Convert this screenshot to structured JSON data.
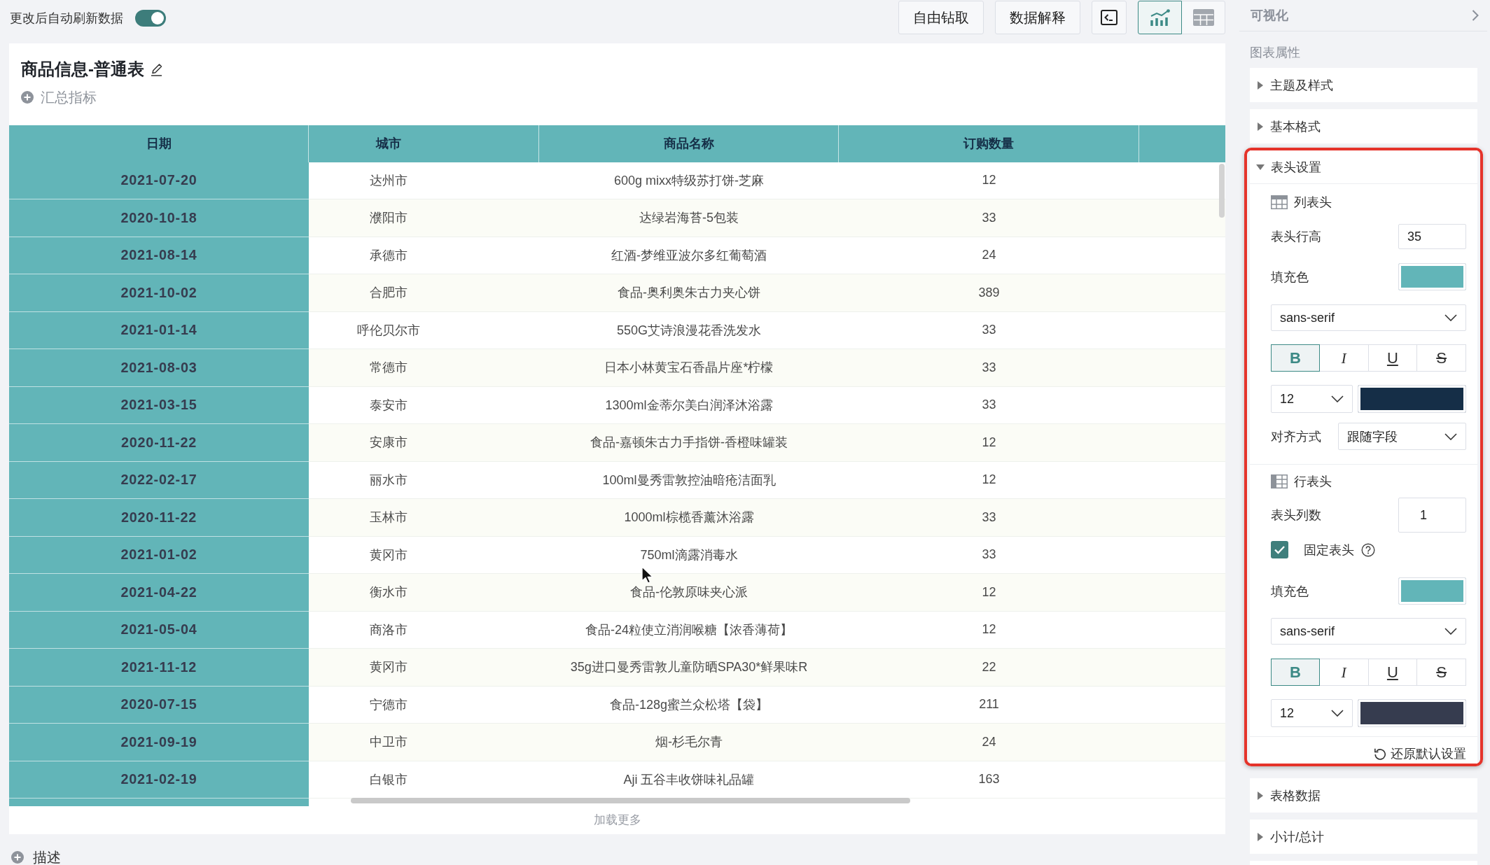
{
  "toolbar": {
    "auto_refresh": {
      "label": "更改后自动刷新数据",
      "on": true
    },
    "buttons": [
      {
        "label": "自由钻取"
      },
      {
        "label": "数据解释"
      }
    ],
    "view_modes": [
      {
        "kind": "chart",
        "selected": true
      },
      {
        "kind": "table",
        "selected": false
      }
    ]
  },
  "report": {
    "title": "商品信息-普通表",
    "summary": "汇总指标",
    "table": {
      "columns": [
        "日期",
        "城市",
        "商品名称",
        "订购数量"
      ],
      "rows": [
        [
          "2021-07-20",
          "达州市",
          "600g mixx特级苏打饼-芝麻",
          "12"
        ],
        [
          "2020-10-18",
          "濮阳市",
          "达绿岩海苔-5包装",
          "33"
        ],
        [
          "2021-08-14",
          "承德市",
          "红酒-梦维亚波尔多红葡萄酒",
          "24"
        ],
        [
          "2021-10-02",
          "合肥市",
          "食品-奥利奥朱古力夹心饼",
          "389"
        ],
        [
          "2021-01-14",
          "呼伦贝尔市",
          "550G艾诗浪漫花香洗发水",
          "33"
        ],
        [
          "2021-08-03",
          "常德市",
          "日本小林黄宝石香晶片座*柠檬",
          "33"
        ],
        [
          "2021-03-15",
          "泰安市",
          "1300ml金蒂尔美白润泽沐浴露",
          "33"
        ],
        [
          "2020-11-22",
          "安康市",
          "食品-嘉顿朱古力手指饼-香橙味罐装",
          "12"
        ],
        [
          "2022-02-17",
          "丽水市",
          "100ml曼秀雷敦控油暗疮洁面乳",
          "12"
        ],
        [
          "2020-11-22",
          "玉林市",
          "1000ml棕榄香薰沐浴露",
          "33"
        ],
        [
          "2021-01-02",
          "黄冈市",
          "750ml滴露消毒水",
          "33"
        ],
        [
          "2021-04-22",
          "衡水市",
          "食品-伦敦原味夹心派",
          "12"
        ],
        [
          "2021-05-04",
          "商洛市",
          "食品-24粒使立消润喉糖【浓香薄荷】",
          "12"
        ],
        [
          "2021-11-12",
          "黄冈市",
          "35g进口曼秀雷敦儿童防晒SPA30*鲜果味R",
          "22"
        ],
        [
          "2020-07-15",
          "宁德市",
          "食品-128g蜜兰众松塔【袋】",
          "211"
        ],
        [
          "2021-09-19",
          "中卫市",
          "烟-杉毛尔青",
          "24"
        ],
        [
          "2021-02-19",
          "白银市",
          "Aji 五谷丰收饼味礼品罐",
          "163"
        ]
      ]
    },
    "load_more": "加载更多"
  },
  "description": "描述",
  "panel": {
    "title": "可视化",
    "heading": "图表属性",
    "sections": [
      {
        "label": "主题及样式",
        "expanded": false,
        "highlighted": false
      },
      {
        "label": "基本格式",
        "expanded": false,
        "highlighted": false
      },
      {
        "label": "表头设置",
        "expanded": true,
        "highlighted": true,
        "groups": [
          {
            "kind": "column_header",
            "title": "列表头",
            "height": {
              "label": "表头行高",
              "value": "35"
            },
            "fill": {
              "label": "填充色",
              "color": "#62b5b8"
            },
            "font": "sans-serif",
            "styles": [
              {
                "kind": "bold",
                "label": "B",
                "selected": true
              },
              {
                "kind": "italic",
                "label": "I",
                "selected": false
              },
              {
                "kind": "underline",
                "label": "U",
                "selected": false
              },
              {
                "kind": "strike",
                "label": "S",
                "selected": false
              }
            ],
            "font_size": "12",
            "font_color": {
              "color": "#152e47"
            },
            "align": {
              "label": "对齐方式",
              "value": "跟随字段"
            }
          },
          {
            "kind": "row_header",
            "title": "行表头",
            "count": {
              "label": "表头列数",
              "value": "1"
            },
            "freeze": {
              "label": "固定表头",
              "checked": true
            },
            "fill": {
              "label": "填充色",
              "color": "#62b5b8"
            },
            "font": "sans-serif",
            "styles": [
              {
                "kind": "bold",
                "label": "B",
                "selected": true
              },
              {
                "kind": "italic",
                "label": "I",
                "selected": false
              },
              {
                "kind": "underline",
                "label": "U",
                "selected": false
              },
              {
                "kind": "strike",
                "label": "S",
                "selected": false
              }
            ],
            "font_size": "12",
            "font_color": {
              "color": "#363c4f"
            }
          }
        ],
        "reset": "还原默认设置"
      },
      {
        "label": "表格数据",
        "expanded": false,
        "highlighted": false
      },
      {
        "label": "小计/总计",
        "expanded": false,
        "highlighted": false
      }
    ]
  }
}
